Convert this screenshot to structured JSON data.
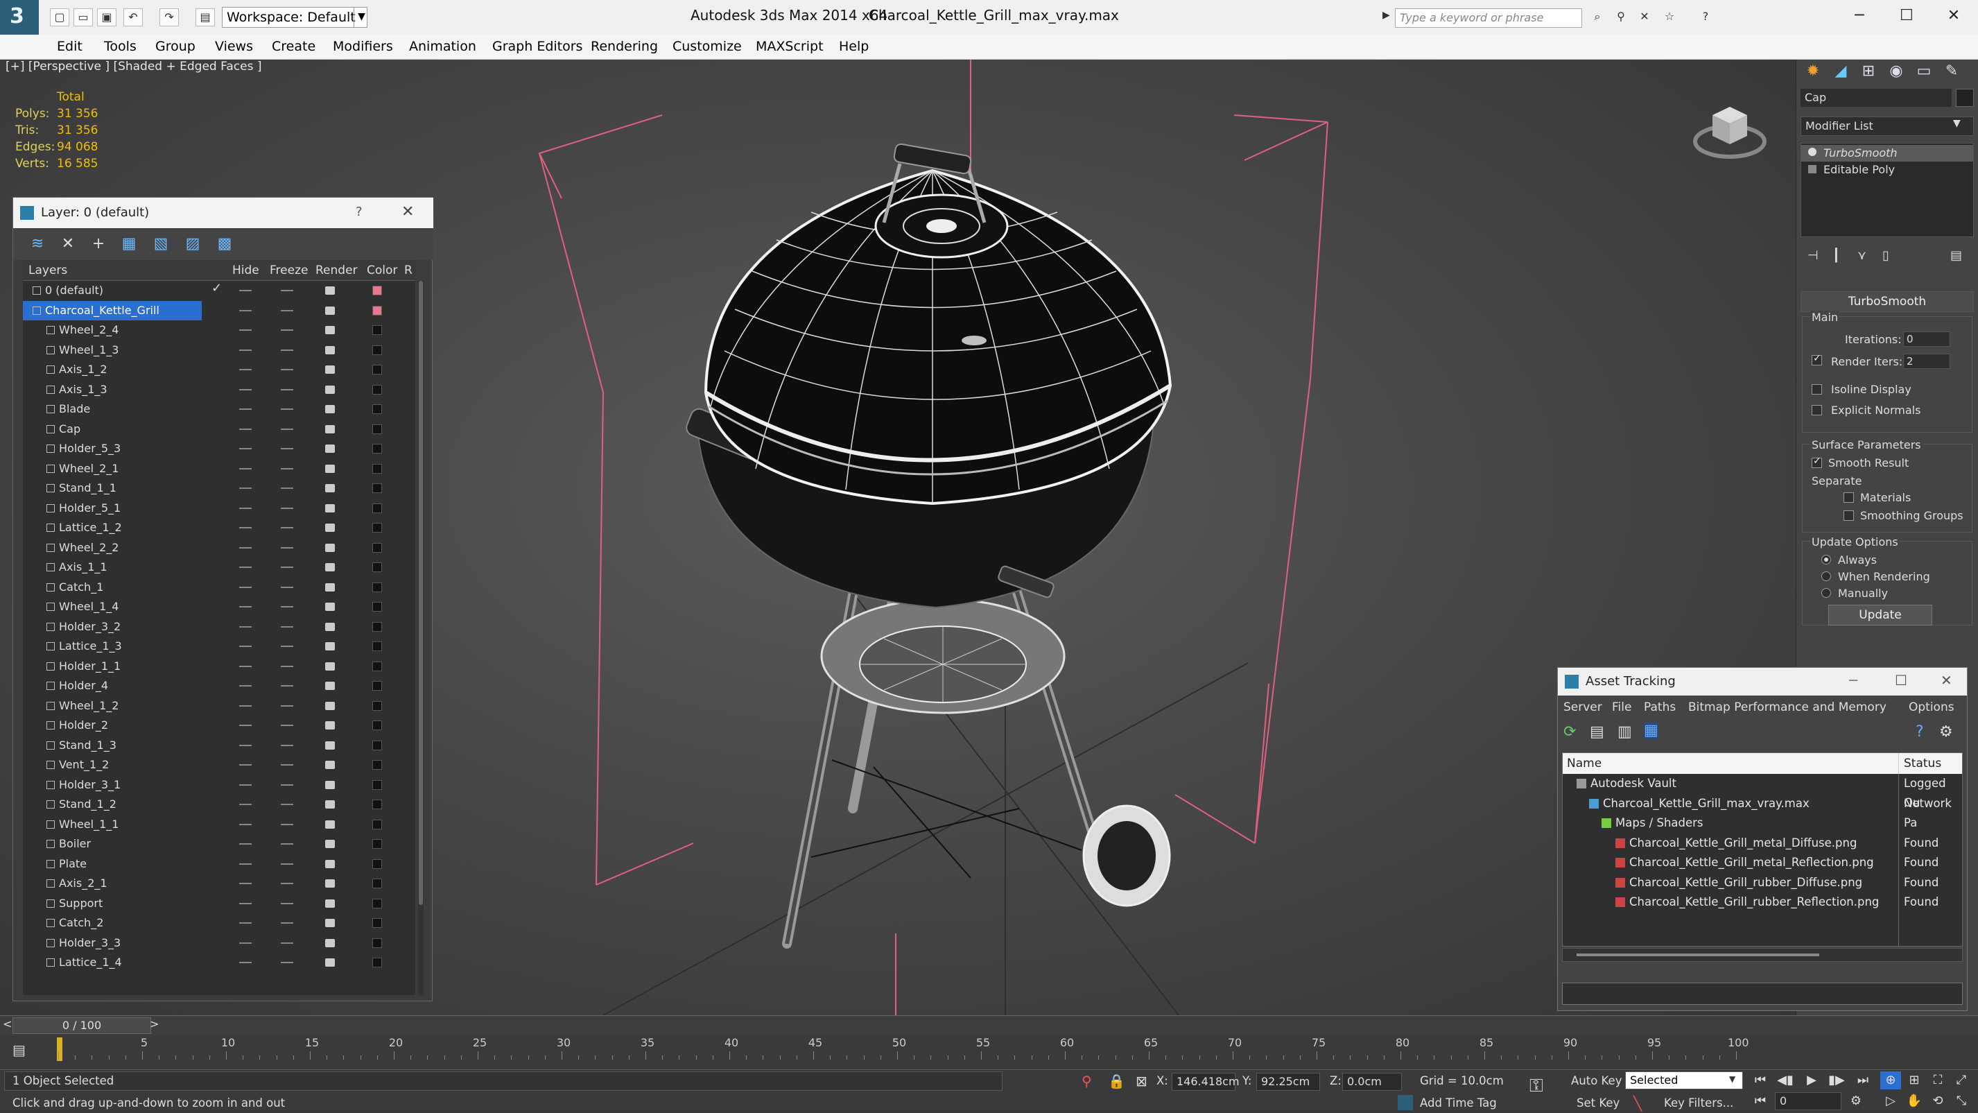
{
  "titlebar": {
    "workspace": "Workspace: Default",
    "app_title": "Autodesk 3ds Max  2014 x64",
    "doc_title": "Charcoal_Kettle_Grill_max_vray.max",
    "search_placeholder": "Type a keyword or phrase"
  },
  "menu": [
    "Edit",
    "Tools",
    "Group",
    "Views",
    "Create",
    "Modifiers",
    "Animation",
    "Graph Editors",
    "Rendering",
    "Customize",
    "MAXScript",
    "Help"
  ],
  "viewport": {
    "label": "[+] [Perspective ] [Shaded + Edged Faces ]",
    "stats_header": "Total",
    "stats": [
      {
        "label": "Polys:",
        "value": "31 356"
      },
      {
        "label": "Tris:",
        "value": "31 356"
      },
      {
        "label": "Edges:",
        "value": "94 068"
      },
      {
        "label": "Verts:",
        "value": "16 585"
      }
    ]
  },
  "layer_panel": {
    "title": "Layer: 0 (default)",
    "help": "?",
    "columns": [
      "Layers",
      "Hide",
      "Freeze",
      "Render",
      "Color",
      "R"
    ],
    "rows": [
      "0 (default)",
      "Charcoal_Kettle_Grill",
      "Wheel_2_4",
      "Wheel_1_3",
      "Axis_1_2",
      "Axis_1_3",
      "Blade",
      "Cap",
      "Holder_5_3",
      "Wheel_2_1",
      "Stand_1_1",
      "Holder_5_1",
      "Lattice_1_2",
      "Wheel_2_2",
      "Axis_1_1",
      "Catch_1",
      "Wheel_1_4",
      "Holder_3_2",
      "Lattice_1_3",
      "Holder_1_1",
      "Holder_4",
      "Wheel_1_2",
      "Holder_2",
      "Stand_1_3",
      "Vent_1_2",
      "Holder_3_1",
      "Stand_1_2",
      "Wheel_1_1",
      "Boiler",
      "Plate",
      "Axis_2_1",
      "Support",
      "Catch_2",
      "Holder_3_3",
      "Lattice_1_4"
    ]
  },
  "command_panel": {
    "object_name": "Cap",
    "modifier_list": "Modifier List",
    "stack": [
      "TurboSmooth",
      "Editable Poly"
    ],
    "turbosmooth": {
      "title": "TurboSmooth",
      "main": "Main",
      "iterations_label": "Iterations:",
      "iterations": "0",
      "render_iters_label": "Render Iters:",
      "render_iters": "2",
      "isoline": "Isoline Display",
      "explicit": "Explicit Normals",
      "surface": "Surface Parameters",
      "smooth_result": "Smooth Result",
      "separate": "Separate",
      "materials": "Materials",
      "smoothing_groups": "Smoothing Groups",
      "update_options": "Update Options",
      "always": "Always",
      "when_rendering": "When Rendering",
      "manually": "Manually",
      "update": "Update"
    }
  },
  "asset_tracking": {
    "title": "Asset Tracking",
    "menu": [
      "Server",
      "File",
      "Paths",
      "Bitmap Performance and Memory",
      "Options"
    ],
    "col_name": "Name",
    "col_status": "Status",
    "rows": [
      {
        "name": "Autodesk Vault",
        "status": "Logged Ou"
      },
      {
        "name": "Charcoal_Kettle_Grill_max_vray.max",
        "status": "Network Pa"
      },
      {
        "name": "Maps / Shaders",
        "status": ""
      },
      {
        "name": "Charcoal_Kettle_Grill_metal_Diffuse.png",
        "status": "Found"
      },
      {
        "name": "Charcoal_Kettle_Grill_metal_Reflection.png",
        "status": "Found"
      },
      {
        "name": "Charcoal_Kettle_Grill_rubber_Diffuse.png",
        "status": "Found"
      },
      {
        "name": "Charcoal_Kettle_Grill_rubber_Reflection.png",
        "status": "Found"
      }
    ]
  },
  "timeline": {
    "frame": "0 / 100",
    "ticks": [
      "5",
      "10",
      "15",
      "20",
      "25",
      "30",
      "35",
      "40",
      "45",
      "50",
      "55",
      "60",
      "65",
      "70",
      "75",
      "80",
      "85",
      "90",
      "95",
      "100"
    ]
  },
  "status": {
    "selection": "1 Object Selected",
    "hint": "Click and drag up-and-down to zoom in and out",
    "x_label": "X:",
    "x": "146.418cm",
    "y_label": "Y:",
    "y": "92.25cm",
    "z_label": "Z:",
    "z": "0.0cm",
    "grid": "Grid = 10.0cm",
    "add_time_tag": "Add Time Tag",
    "auto_key": "Auto Key",
    "selected": "Selected",
    "set_key": "Set Key",
    "key_filters": "Key Filters...",
    "frame": "0"
  }
}
